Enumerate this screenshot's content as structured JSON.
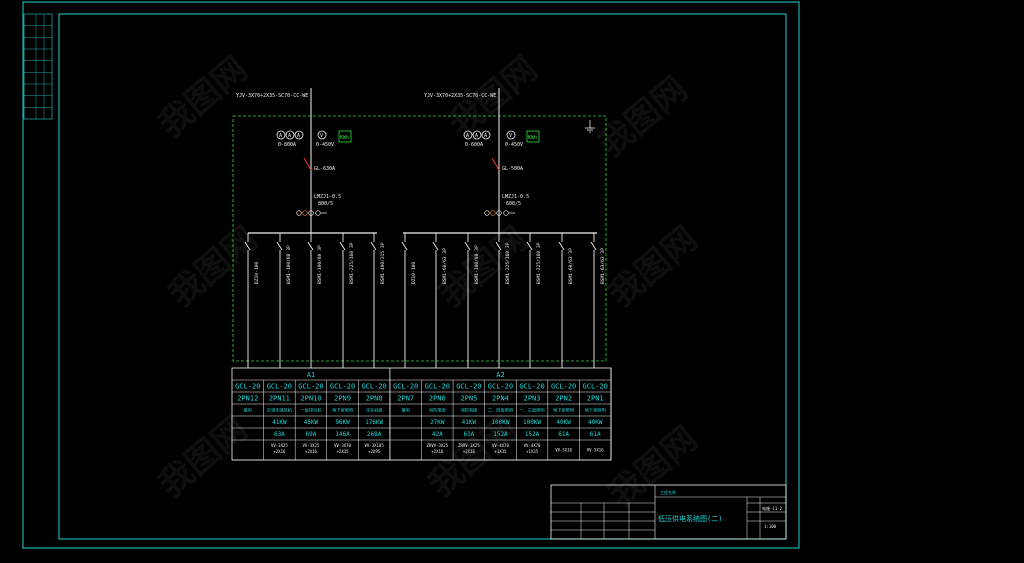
{
  "feeders": [
    {
      "label": "YJV-3X70+2X35-SC70-CC-WE",
      "ammeter_range": "0-800A",
      "voltmeter_range": "0-450V",
      "meter_label": "KWh",
      "breaker": "GL-630A",
      "ct": "LMZJ1-0.5",
      "ct_ratio": "800/5"
    },
    {
      "label": "YJV-3X70+2X35-SC70-CC-WE",
      "ammeter_range": "0-600A",
      "voltmeter_range": "0-450V",
      "meter_label": "KWh",
      "breaker": "GL-500A",
      "ct": "LMZJ1-0.5",
      "ct_ratio": "600/5"
    }
  ],
  "switches": [
    {
      "label": "DZ10-100"
    },
    {
      "label": "BSM1-100/80 3P"
    },
    {
      "label": "BSM1-100/80 3P"
    },
    {
      "label": "BSM1-225/160 3P"
    },
    {
      "label": "BSM1-400/315 3P"
    },
    {
      "label": "DZ10-100"
    },
    {
      "label": "BSM1-60/63 3P"
    },
    {
      "label": "BSM1-100/80 3P"
    },
    {
      "label": "BSM1-225/160 3P"
    },
    {
      "label": "BSM1-225/160 3P"
    },
    {
      "label": "BSM1-60/63 3P"
    },
    {
      "label": "BSM1-63/63 3P"
    }
  ],
  "table": {
    "groups": [
      {
        "label": "A1",
        "span": 5
      },
      {
        "label": "A2",
        "span": 7
      }
    ],
    "rows": [
      [
        "GCL-20",
        "GCL-20",
        "GCL-20",
        "GCL-20",
        "GCL-20",
        "GCL-20",
        "GCL-20",
        "GCL-20",
        "GCL-20",
        "GCL-20",
        "GCL-20",
        "GCL-20"
      ],
      [
        "2PN12",
        "2PN11",
        "2PN10",
        "2PN9",
        "2PN8",
        "2PN7",
        "2PN6",
        "2PN5",
        "2PN4",
        "2PN3",
        "2PN2",
        "2PN1"
      ],
      [
        "备用",
        "空调末端风机",
        "一层排风机",
        "地下室照明",
        "冷冻机组",
        "备用",
        "消防电源",
        "消防电梯",
        "二、四层照明",
        "一、三层照明",
        "地下室照明",
        "地下室照明"
      ],
      [
        "",
        "41KW",
        "45KW",
        "96KW",
        "176KW",
        "",
        "27KW",
        "41KW",
        "100KW",
        "100KW",
        "40KW",
        "40KW"
      ],
      [
        "",
        "63A",
        "69A",
        "146A",
        "268A",
        "",
        "42A",
        "63A",
        "152A",
        "152A",
        "61A",
        "61A"
      ],
      [
        "",
        "VV-3X25\n+2X16",
        "VV-3X25\n+2X16",
        "VV-3X70\n+2X35",
        "VV-3X185\n+2X95",
        "",
        "ZRVV-3X25\n+2X16",
        "ZRVV-3X25\n+2X16",
        "VV-4X70\n+1X35",
        "VV-4X70\n+1X35",
        "VV-5X16",
        "VV-5X16"
      ]
    ]
  },
  "title_block": {
    "title": "低压供电系统图(二)",
    "drawing_no": "电施-11-2",
    "scale": "1:100",
    "project_label": "工程名称"
  },
  "side_strip_rows": 9,
  "watermark": "我图网",
  "colors": {
    "frame": "#1fd4d4",
    "lines": "#f2f2f2",
    "ground": "#2fdc3a",
    "background": "#000000"
  }
}
